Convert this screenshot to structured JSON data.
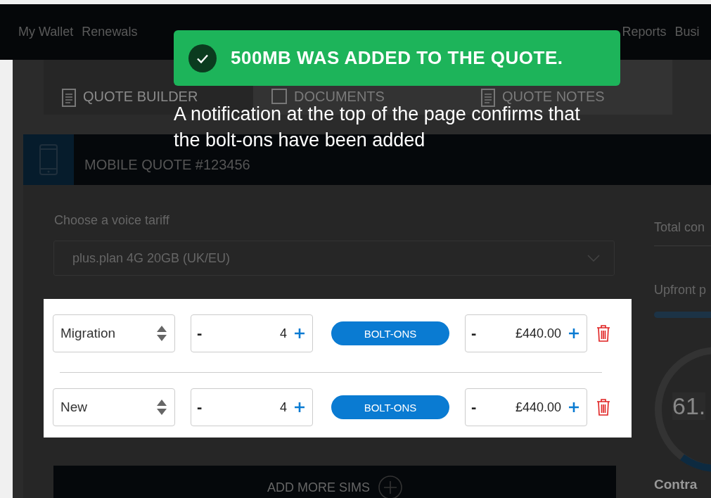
{
  "nav": {
    "items": [
      {
        "label": "My Wallet"
      },
      {
        "label": "Renewals"
      },
      {
        "label": "Reports"
      },
      {
        "label": "Busi"
      }
    ]
  },
  "toast": {
    "message": "500MB WAS ADDED TO THE QUOTE."
  },
  "caption": "A notification at the top of the page confirms that the bolt-ons have been added",
  "tabs": [
    {
      "label": "QUOTE BUILDER",
      "selected": true
    },
    {
      "label": "DOCUMENTS",
      "selected": false
    },
    {
      "label": "QUOTE NOTES",
      "selected": false
    }
  ],
  "quote": {
    "title": "MOBILE QUOTE #123456",
    "tariff_label": "Choose a voice tariff",
    "tariff_value": "plus.plan 4G 20GB (UK/EU)",
    "rows": [
      {
        "type": "Migration",
        "quantity_minus": "-",
        "quantity": "4",
        "bolt_ons": "BOLT-ONS",
        "price_minus": "-",
        "price": "£440.00"
      },
      {
        "type": "New",
        "quantity_minus": "-",
        "quantity": "4",
        "bolt_ons": "BOLT-ONS",
        "price_minus": "-",
        "price": "£440.00"
      }
    ],
    "add_more": "ADD MORE SIMS"
  },
  "summary": {
    "total_label": "Total con",
    "upfront_label": "Upfront p",
    "donut_value": "61.",
    "contract_label": "Contra"
  }
}
